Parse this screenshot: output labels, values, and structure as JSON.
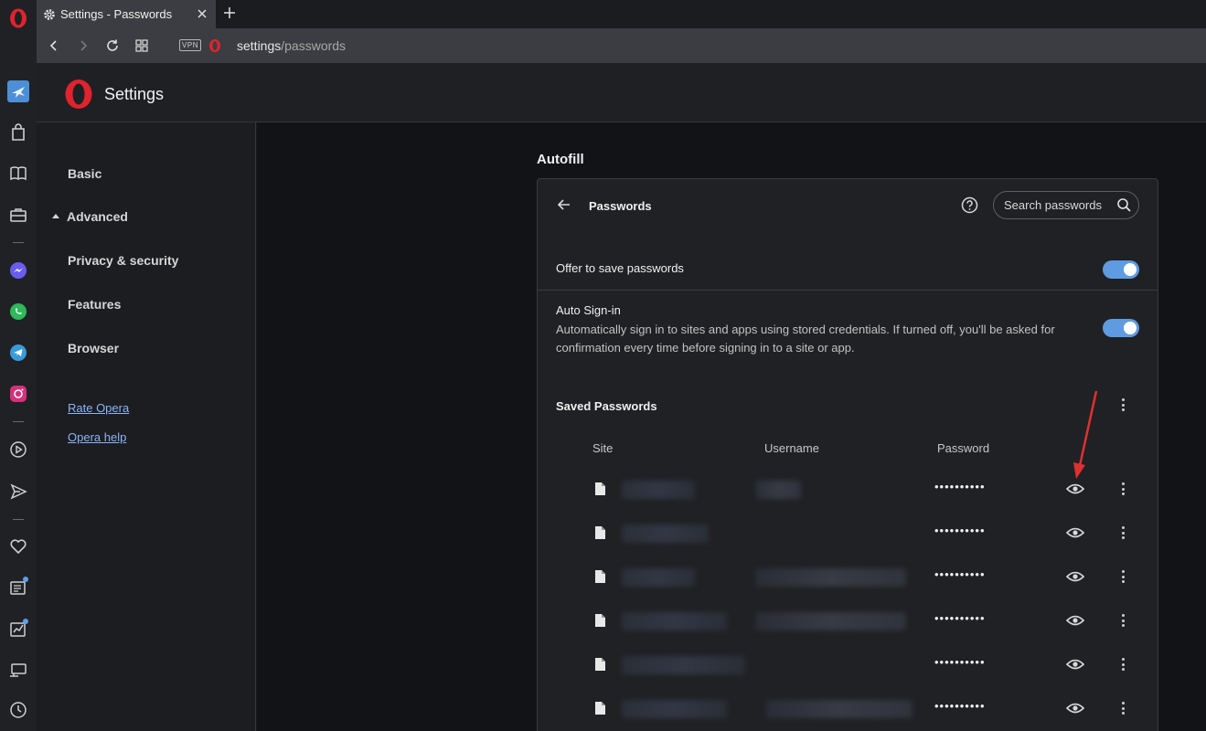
{
  "browser": {
    "tab": {
      "title": "Settings - Passwords"
    },
    "address": {
      "vpn_label": "VPN",
      "url_host": "settings",
      "url_path": "/passwords"
    }
  },
  "header": {
    "title": "Settings"
  },
  "nav": {
    "basic": "Basic",
    "advanced": "Advanced",
    "privacy": "Privacy & security",
    "features": "Features",
    "browser": "Browser",
    "rate": "Rate Opera",
    "help": "Opera help"
  },
  "main": {
    "section_title": "Autofill",
    "card_title": "Passwords",
    "search": {
      "placeholder": "Search passwords"
    },
    "offer": {
      "label": "Offer to save passwords",
      "enabled": true
    },
    "autosign": {
      "label": "Auto Sign-in",
      "description": "Automatically sign in to sites and apps using stored credentials. If turned off, you'll be asked for confirmation every time before signing in to a site or app.",
      "enabled": true
    },
    "saved_title": "Saved Passwords",
    "columns": {
      "site": "Site",
      "username": "Username",
      "password": "Password"
    },
    "rows": [
      {
        "password": "••••••••••"
      },
      {
        "password": "••••••••••"
      },
      {
        "password": "••••••••••"
      },
      {
        "password": "••••••••••"
      },
      {
        "password": "••••••••••"
      },
      {
        "password": "••••••••••"
      }
    ]
  },
  "colors": {
    "accent": "#5f9be0",
    "opera_red": "#e0232e",
    "annotation_arrow": "#e03030"
  }
}
